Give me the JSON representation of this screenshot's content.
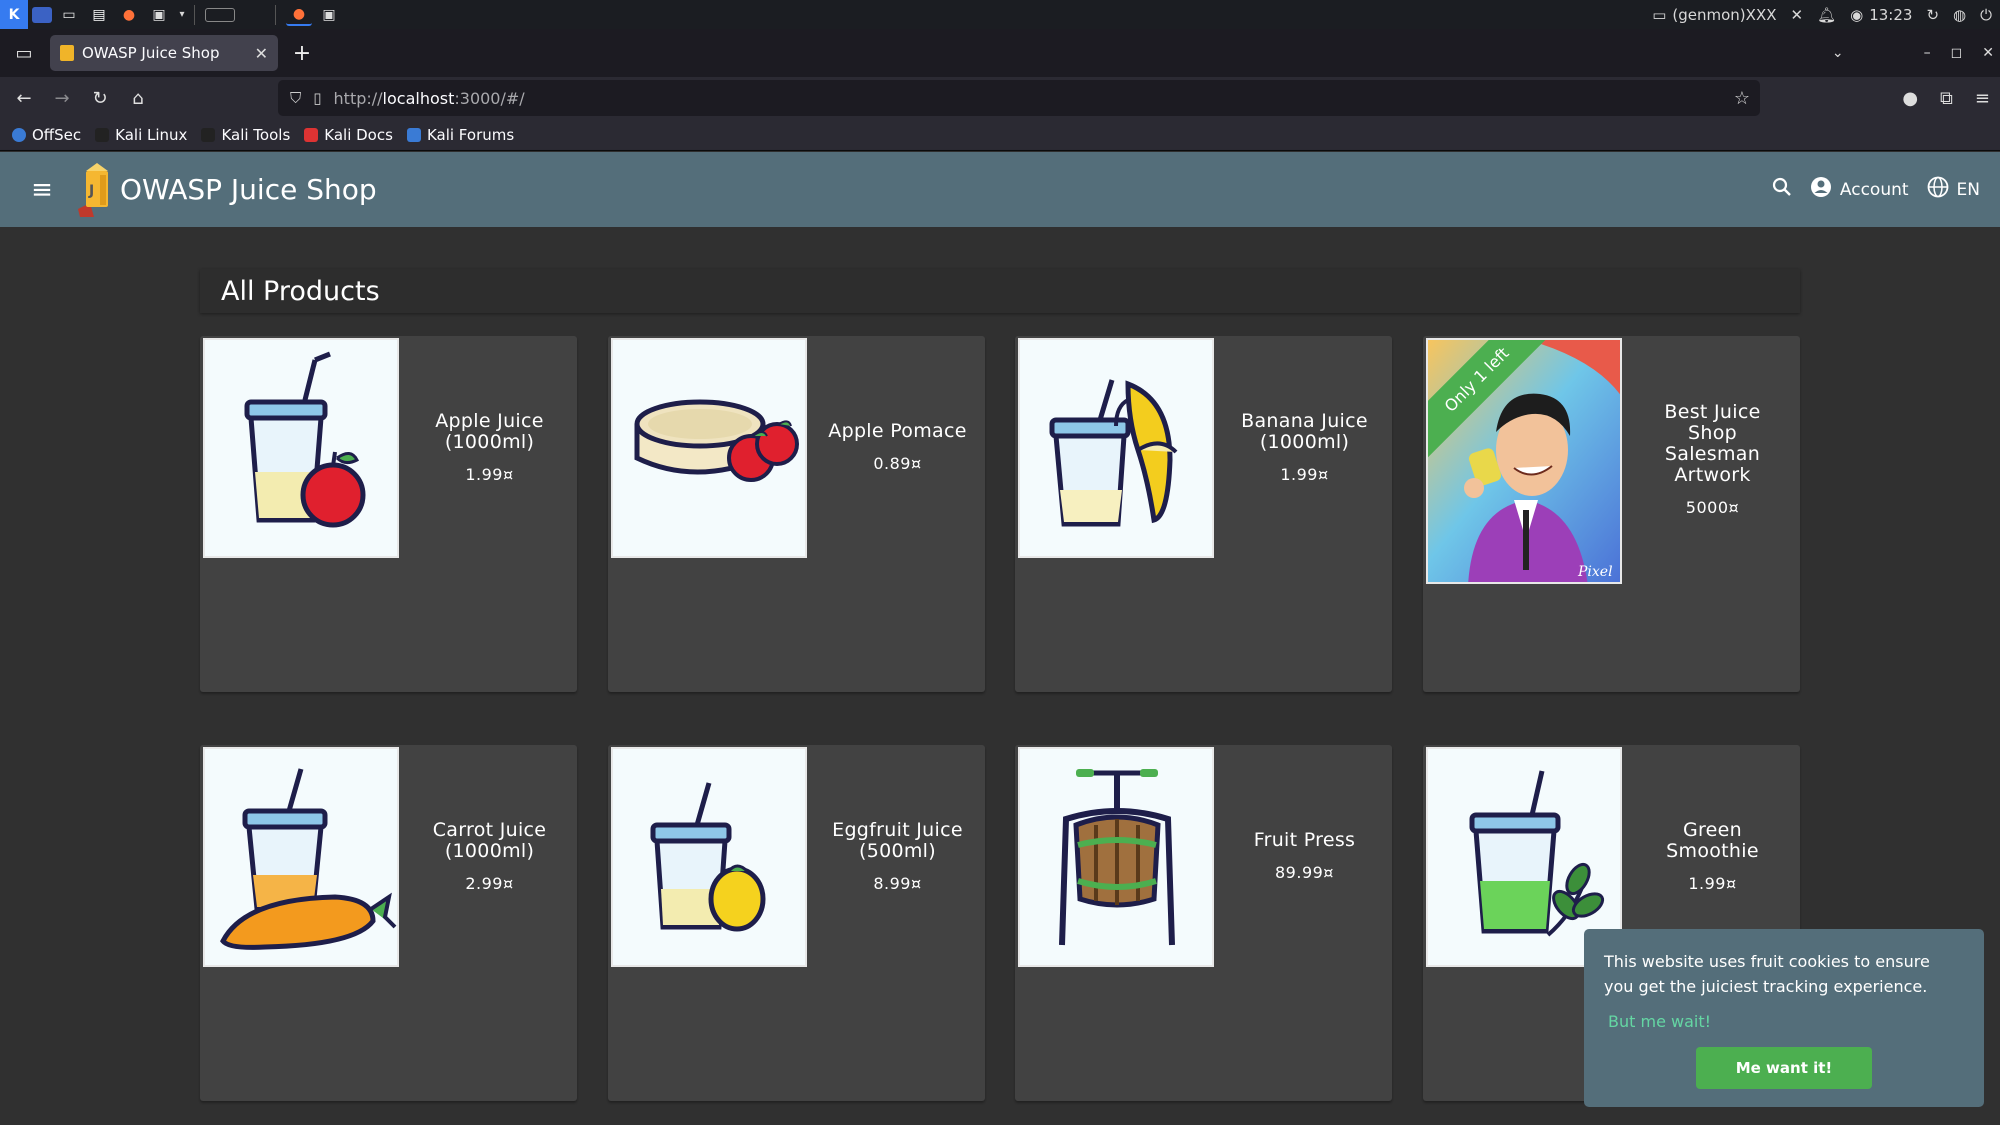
{
  "os": {
    "genmon_label": "(genmon)XXX",
    "clock": "13:23"
  },
  "browser": {
    "tab_title": "OWASP Juice Shop",
    "url_prefix": "http://",
    "url_host": "localhost",
    "url_rest": ":3000/#/",
    "bookmarks": [
      "OffSec",
      "Kali Linux",
      "Kali Tools",
      "Kali Docs",
      "Kali Forums"
    ]
  },
  "app": {
    "title": "OWASP Juice Shop",
    "account_label": "Account",
    "language_label": "EN",
    "heading": "All Products"
  },
  "products": [
    {
      "name": "Apple Juice (1000ml)",
      "price": "1.99¤",
      "image": "apple-juice-icon"
    },
    {
      "name": "Apple Pomace",
      "price": "0.89¤",
      "image": "apple-pomace-icon"
    },
    {
      "name": "Banana Juice (1000ml)",
      "price": "1.99¤",
      "image": "banana-juice-icon"
    },
    {
      "name": "Best Juice Shop Salesman Artwork",
      "price": "5000¤",
      "image": "salesman-artwork",
      "ribbon": "Only 1 left"
    },
    {
      "name": "Carrot Juice (1000ml)",
      "price": "2.99¤",
      "image": "carrot-juice-icon"
    },
    {
      "name": "Eggfruit Juice (500ml)",
      "price": "8.99¤",
      "image": "eggfruit-juice-icon"
    },
    {
      "name": "Fruit Press",
      "price": "89.99¤",
      "image": "fruit-press-icon"
    },
    {
      "name": "Green Smoothie",
      "price": "1.99¤",
      "image": "green-smoothie-icon"
    }
  ],
  "cookie": {
    "message": "This website uses fruit cookies to ensure you get the juiciest tracking experience.",
    "dismiss": "But me wait!",
    "accept": "Me want it!"
  }
}
